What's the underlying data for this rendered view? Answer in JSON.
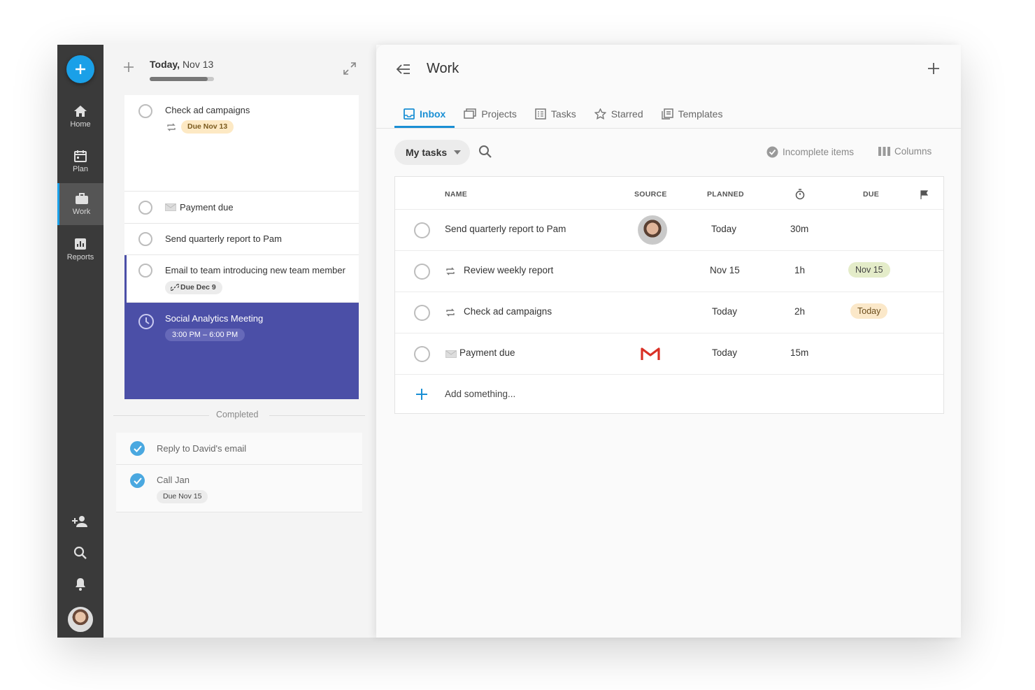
{
  "rail": {
    "items": [
      {
        "label": "Home"
      },
      {
        "label": "Plan"
      },
      {
        "label": "Work"
      },
      {
        "label": "Reports"
      }
    ]
  },
  "today": {
    "title_bold": "Today,",
    "title_date": "Nov 13",
    "progress": 0.9,
    "tasks": [
      {
        "name": "Check ad campaigns",
        "chip": "Due Nov 13"
      },
      {
        "name": "Payment due"
      },
      {
        "name": "Send quarterly report to Pam"
      },
      {
        "name": "Email to team introducing new team member",
        "chip": "Due Dec 9"
      }
    ],
    "meeting": {
      "name": "Social Analytics Meeting",
      "time": "3:00 PM – 6:00 PM"
    },
    "completed_label": "Completed",
    "completed": [
      {
        "name": "Reply to David's email"
      },
      {
        "name": "Call Jan",
        "chip": "Due Nov 15"
      }
    ]
  },
  "work": {
    "title": "Work",
    "tabs": [
      {
        "label": "Inbox",
        "icon": "inbox-icon"
      },
      {
        "label": "Projects",
        "icon": "projects-icon"
      },
      {
        "label": "Tasks",
        "icon": "tasks-icon"
      },
      {
        "label": "Starred",
        "icon": "star-icon"
      },
      {
        "label": "Templates",
        "icon": "templates-icon"
      }
    ],
    "filter_label": "My tasks",
    "incomplete_label": "Incomplete items",
    "columns_label": "Columns",
    "headers": {
      "name": "NAME",
      "source": "SOURCE",
      "planned": "PLANNED",
      "due": "DUE"
    },
    "rows": [
      {
        "name": "Send quarterly report to Pam",
        "source": "avatar",
        "planned": "Today",
        "duration": "30m",
        "due": ""
      },
      {
        "name": "Review weekly report",
        "source": "",
        "planned": "Nov 15",
        "duration": "1h",
        "due": "Nov 15"
      },
      {
        "name": "Check ad campaigns",
        "source": "",
        "planned": "Today",
        "duration": "2h",
        "due": "Today"
      },
      {
        "name": "Payment due",
        "source": "gmail",
        "planned": "Today",
        "duration": "15m",
        "due": ""
      }
    ],
    "add_placeholder": "Add something..."
  },
  "colors": {
    "accent": "#1aa0e8",
    "rail": "#3a3a3a",
    "meeting": "#4b4fa7",
    "chip_orange": "#fde9c4",
    "chip_green": "#e4ecc9"
  }
}
